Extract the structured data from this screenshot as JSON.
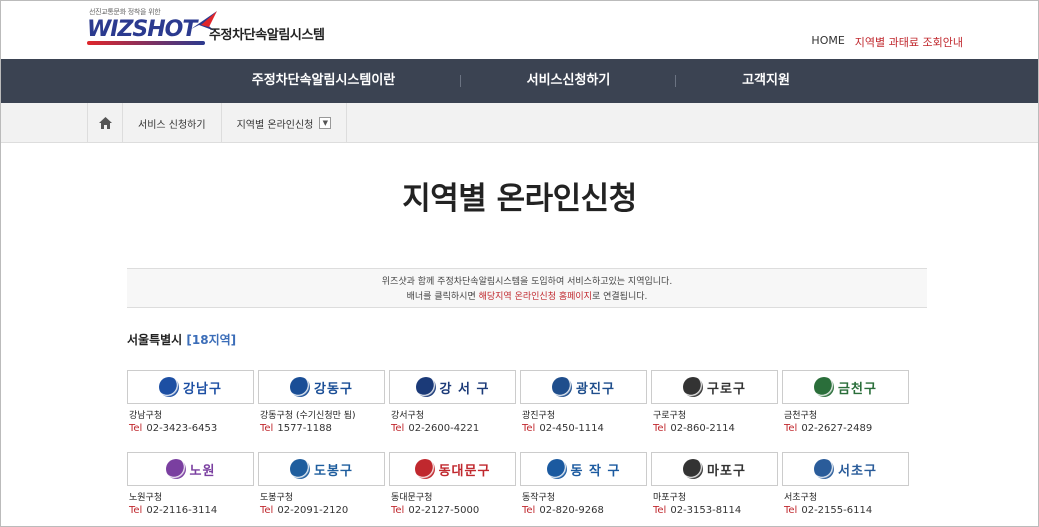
{
  "header": {
    "logo_tagline": "선진교통문화 정착을 위한",
    "logo_brand": "WIZSHOT",
    "logo_system": "주정차단속알림시스템",
    "home_link": "HOME",
    "fine_link": "지역별 과태료 조회안내"
  },
  "nav": {
    "items": [
      {
        "label": "주정차단속알림시스템이란"
      },
      {
        "label": "서비스신청하기"
      },
      {
        "label": "고객지원"
      }
    ]
  },
  "breadcrumb": {
    "items": [
      {
        "label": "서비스 신청하기"
      },
      {
        "label": "지역별 온라인신청"
      }
    ]
  },
  "page": {
    "title": "지역별 온라인신청"
  },
  "notice": {
    "line1": "위즈샷과 함께 주정차단속알림시스템을 도입하여 서비스하고있는 지역입니다.",
    "line2_pre": "배너를 클릭하시면 ",
    "line2_highlight": "해당지역 온라인신청 홈페이지",
    "line2_post": "로 연결됩니다."
  },
  "region": {
    "name": "서울특별시",
    "count": "[18지역]"
  },
  "tel_label": "Tel",
  "districts": [
    {
      "logo": "강남구",
      "name": "강남구청",
      "tel": "02-3423-6453",
      "color": "#1d4fa3",
      "icon": "gangnam-icon"
    },
    {
      "logo": "강동구",
      "name": "강동구청 (수기신청만 됨)",
      "tel": "1577-1188",
      "color": "#1a4e96",
      "icon": "gangdong-icon"
    },
    {
      "logo": "강 서 구",
      "name": "강서구청",
      "tel": "02-2600-4221",
      "color": "#1b3a78",
      "icon": "gangseo-icon"
    },
    {
      "logo": "광진구",
      "name": "광진구청",
      "tel": "02-450-1114",
      "color": "#1f4e8c",
      "icon": "gwangjin-icon"
    },
    {
      "logo": "구로구",
      "name": "구로구청",
      "tel": "02-860-2114",
      "color": "#333333",
      "icon": "guro-icon"
    },
    {
      "logo": "금천구",
      "name": "금천구청",
      "tel": "02-2627-2489",
      "color": "#2a6e3a",
      "icon": "geumcheon-icon"
    },
    {
      "logo": "노원",
      "name": "노원구청",
      "tel": "02-2116-3114",
      "color": "#7a3fa0",
      "icon": "nowon-icon"
    },
    {
      "logo": "도봉구",
      "name": "도봉구청",
      "tel": "02-2091-2120",
      "color": "#1f5e9e",
      "icon": "dobong-icon"
    },
    {
      "logo": "동대문구",
      "name": "동대문구청",
      "tel": "02-2127-5000",
      "color": "#c0282e",
      "icon": "dongdaemun-icon"
    },
    {
      "logo": "동 작 구",
      "name": "동작구청",
      "tel": "02-820-9268",
      "color": "#1b5aa0",
      "icon": "dongjak-icon"
    },
    {
      "logo": "마포구",
      "name": "마포구청",
      "tel": "02-3153-8114",
      "color": "#333333",
      "icon": "mapo-icon"
    },
    {
      "logo": "서초구",
      "name": "서초구청",
      "tel": "02-2155-6114",
      "color": "#2a5c9a",
      "icon": "seocho-icon"
    }
  ]
}
